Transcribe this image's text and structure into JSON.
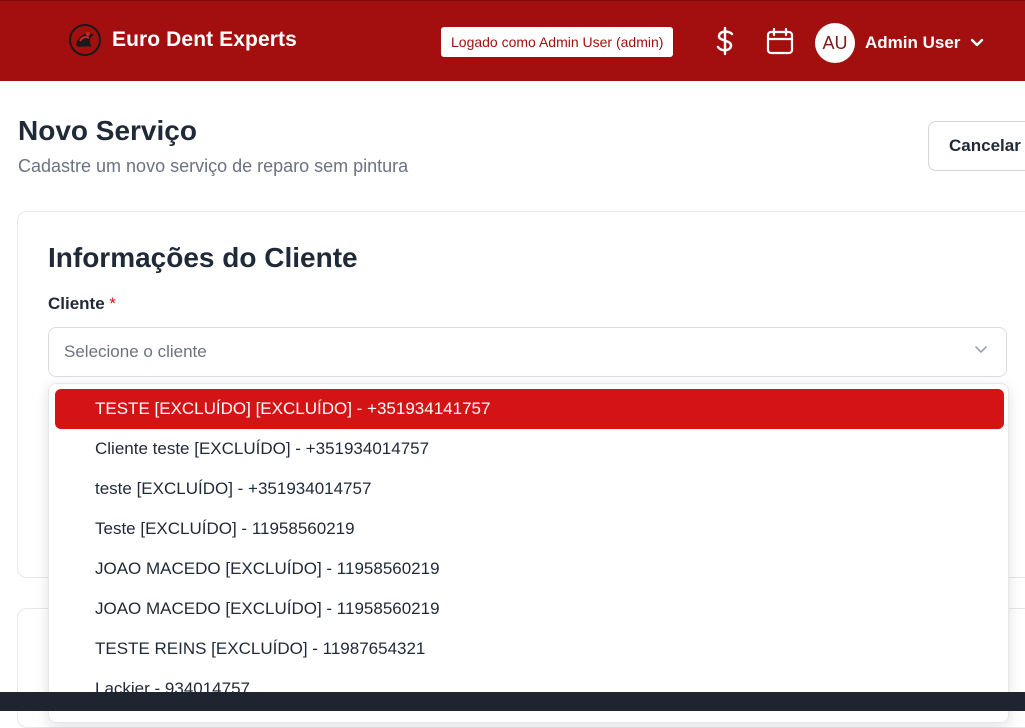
{
  "header": {
    "brand_name": "Euro Dent Experts",
    "logged_as": "Logado como Admin User (admin)",
    "user_initials": "AU",
    "user_name": "Admin User"
  },
  "page": {
    "title": "Novo Serviço",
    "subtitle": "Cadastre um novo serviço de reparo sem pintura",
    "cancel_label": "Cancelar"
  },
  "client_section": {
    "title": "Informações do Cliente",
    "client_label": "Cliente",
    "required_mark": "*",
    "select_placeholder": "Selecione o cliente",
    "options": [
      "TESTE [EXCLUÍDO] [EXCLUÍDO] - +351934141757",
      "Cliente teste [EXCLUÍDO] - +351934014757",
      "teste [EXCLUÍDO] - +351934014757",
      "Teste [EXCLUÍDO] - 11958560219",
      "JOAO MACEDO [EXCLUÍDO] - 11958560219",
      "JOAO MACEDO [EXCLUÍDO] - 11958560219",
      "TESTE REINS [EXCLUÍDO] - 11987654321",
      "Lackier - 934014757"
    ],
    "highlighted_option": "TESTE [EXCLUÍDO] [EXCLUÍDO] - +351934141757"
  },
  "colors": {
    "header_bg": "#a30f0f",
    "highlight": "#d41414"
  }
}
